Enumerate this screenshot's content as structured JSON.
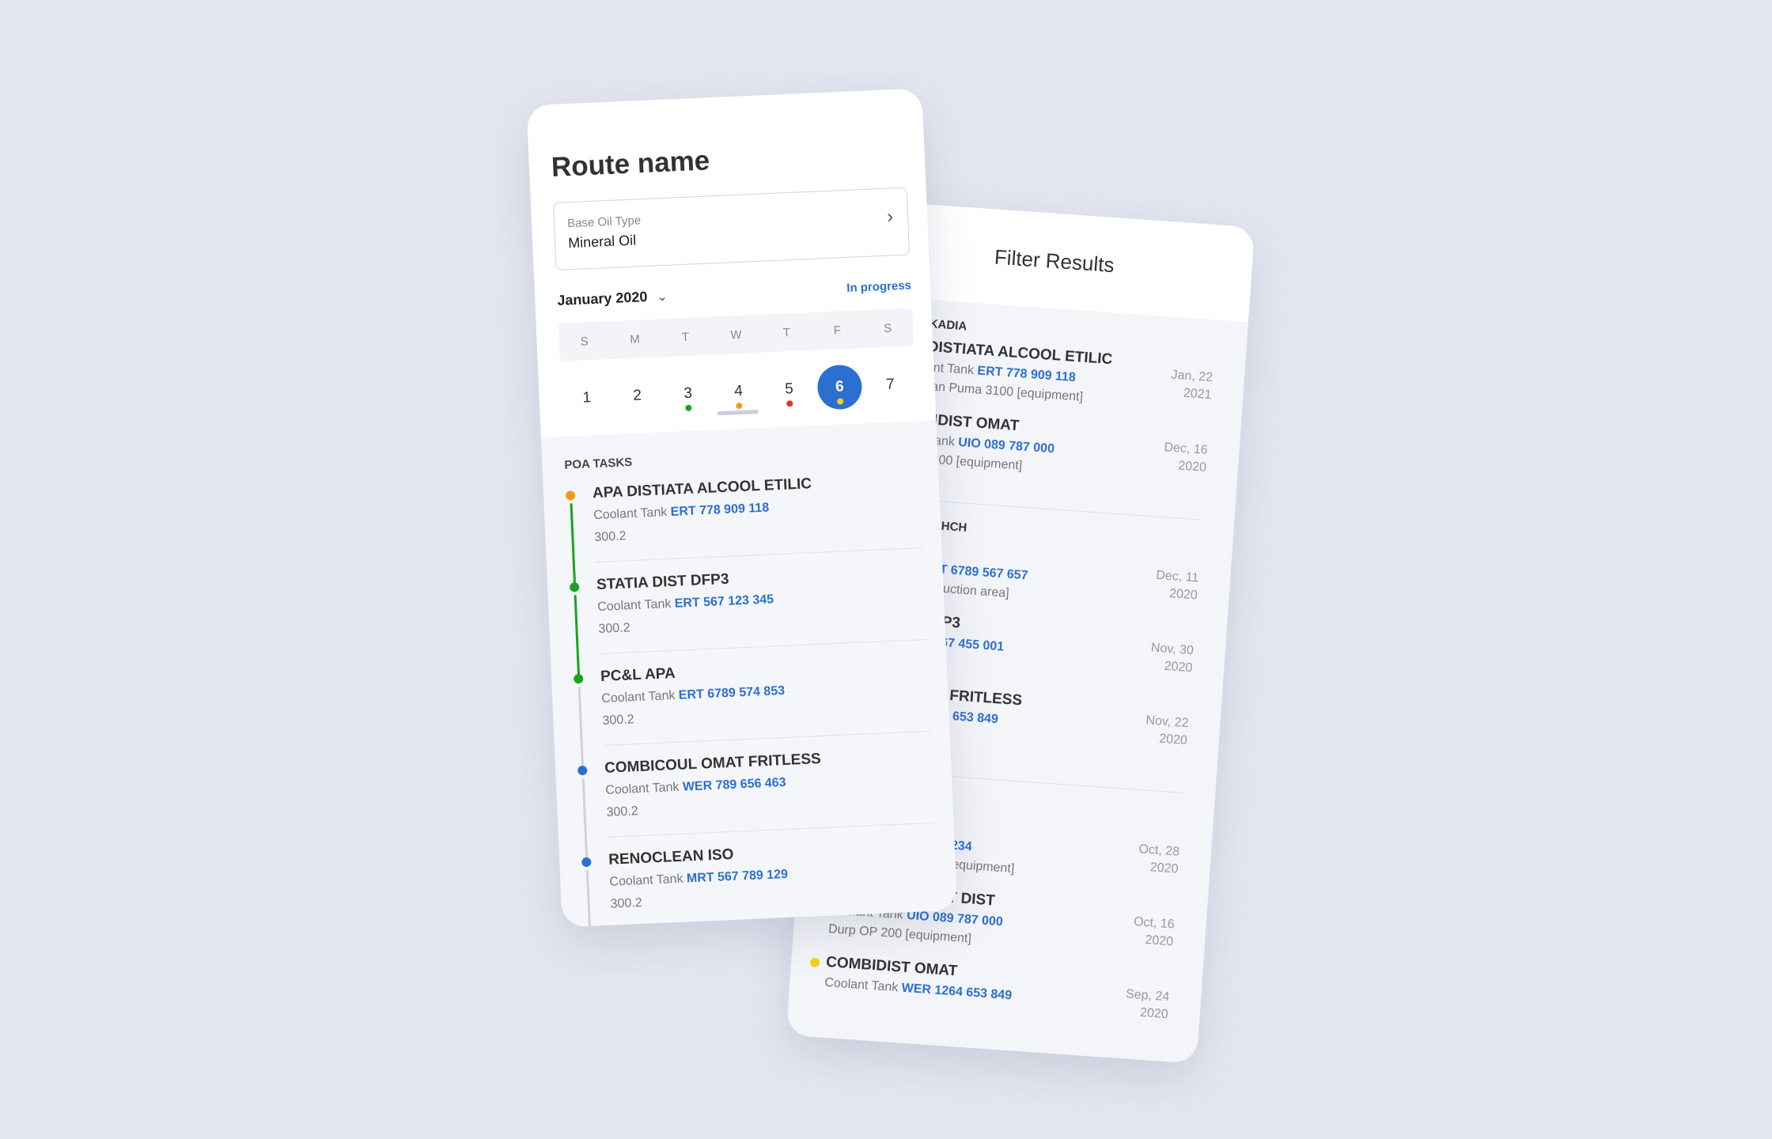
{
  "filter": {
    "title": "Filter Results",
    "groups": [
      {
        "label": "KADIA",
        "items": [
          {
            "title": "DISTIATA ALCOOL ETILIC",
            "sub": "ant Tank",
            "code": "ERT 778 909 118",
            "sub2": "san Puma 3100 [equipment]",
            "date": "Jan, 22",
            "year": "2021"
          },
          {
            "title": "BIDIST OMAT",
            "sub": "t Tank",
            "code": "UIO 089 787 000",
            "sub2": "P 200 [equipment]",
            "date": "Dec, 16",
            "year": "2020"
          }
        ]
      },
      {
        "label": "N 5 LE HCH",
        "items": [
          {
            "title": "PA",
            "sub": "ank",
            "code": "ERT 6789 567 657",
            "sub2": "00 [production area]",
            "date": "Dec, 11",
            "year": "2020"
          },
          {
            "title": "IST DFP3",
            "sub": "k",
            "code": "TDM 567 455 001",
            "sub2": "nent]",
            "date": "Nov, 30",
            "year": "2020"
          },
          {
            "title": "L OMAT FRITLESS",
            "sub": "",
            "code": "WER 1264 653 849",
            "sub2": "equipment]",
            "date": "Nov, 22",
            "year": "2020"
          }
        ]
      },
      {
        "label": "",
        "items": [
          {
            "title": "COOL",
            "sub": "",
            "code": "Y 890 567 234",
            "sub2": "uma 3100 [equipment]",
            "date": "Oct, 28",
            "year": "2020",
            "dot": ""
          },
          {
            "title": "DESEU SOLVENT DIST",
            "sub": "Coolant Tank",
            "code": "UIO 089 787 000",
            "sub2": "Durp OP 200 [equipment]",
            "date": "Oct, 16",
            "year": "2020",
            "dot": "#7a1f86"
          },
          {
            "title": "COMBIDIST OMAT",
            "sub": "Coolant Tank",
            "code": "WER 1264 653 849",
            "sub2": "",
            "date": "Sep, 24",
            "year": "2020",
            "dot": "#f2d21b"
          }
        ]
      }
    ]
  },
  "route": {
    "title": "Route name",
    "field_label": "Base Oil Type",
    "field_value": "Mineral Oil",
    "month": "January 2020",
    "status": "In progress",
    "weekdays": [
      "S",
      "M",
      "T",
      "W",
      "T",
      "F",
      "S"
    ],
    "days": [
      {
        "n": "1"
      },
      {
        "n": "2"
      },
      {
        "n": "3",
        "dot": "#1aa320"
      },
      {
        "n": "4",
        "dot": "#f39a1e"
      },
      {
        "n": "5",
        "dot": "#e2352a"
      },
      {
        "n": "6",
        "dot": "#f2d21b",
        "selected": true
      },
      {
        "n": "7"
      }
    ],
    "section": "POA TASKS",
    "tasks": [
      {
        "title": "APA DISTIATA ALCOOL ETILIC",
        "sub": "Coolant Tank",
        "code": "ERT 778 909 118",
        "value": "300.2",
        "dot": "#f39a1e",
        "line": "#1aa320"
      },
      {
        "title": "STATIA DIST DFP3",
        "sub": "Coolant Tank",
        "code": "ERT 567 123 345",
        "value": "300.2",
        "dot": "#1aa320",
        "line": "#1aa320"
      },
      {
        "title": "PC&L APA",
        "sub": "Coolant Tank",
        "code": "ERT 6789 574 853",
        "value": "300.2",
        "dot": "#1aa320",
        "line": "#cfd3da"
      },
      {
        "title": "COMBICOUL OMAT FRITLESS",
        "sub": "Coolant Tank",
        "code": "WER 789 656 463",
        "value": "300.2",
        "dot": "#2d6fd1",
        "line": "#cfd3da"
      },
      {
        "title": "RENOCLEAN ISO",
        "sub": "Coolant Tank",
        "code": "MRT 567 789 129",
        "value": "300.2",
        "dot": "#2d6fd1",
        "line": "#cfd3da"
      }
    ]
  },
  "colors": {
    "accent": "#2d6fd1",
    "background": "#e4e7f0"
  }
}
